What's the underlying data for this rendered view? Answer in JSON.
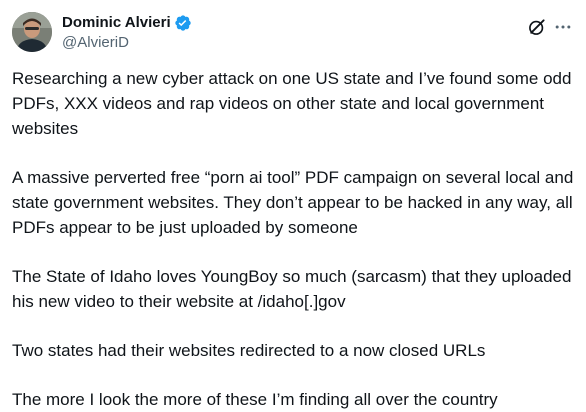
{
  "author": {
    "display_name": "Dominic Alvieri",
    "handle": "@AlvieriD",
    "verified": true,
    "verified_color": "#1d9bf0"
  },
  "header_actions": {
    "grok_icon": "grok-slash-circle-icon",
    "more_icon": "more-horizontal-icon"
  },
  "post": {
    "paragraphs": [
      "Researching a new cyber attack on one US state and I’ve found some odd PDFs, XXX videos and rap videos on other state and local government websites",
      "A massive perverted free “porn ai tool” PDF campaign on several local and state government websites. They don’t appear to be hacked in any way, all PDFs appear to be just uploaded by someone",
      "The State of Idaho loves YoungBoy so much (sarcasm) that they uploaded his new video to their website at /idaho[.]gov",
      "Two states had their websites redirected to a now closed URLs",
      "The more I look the more of these I’m finding all over the country"
    ]
  },
  "colors": {
    "text": "#0f1419",
    "secondary": "#536471",
    "background": "#ffffff"
  }
}
